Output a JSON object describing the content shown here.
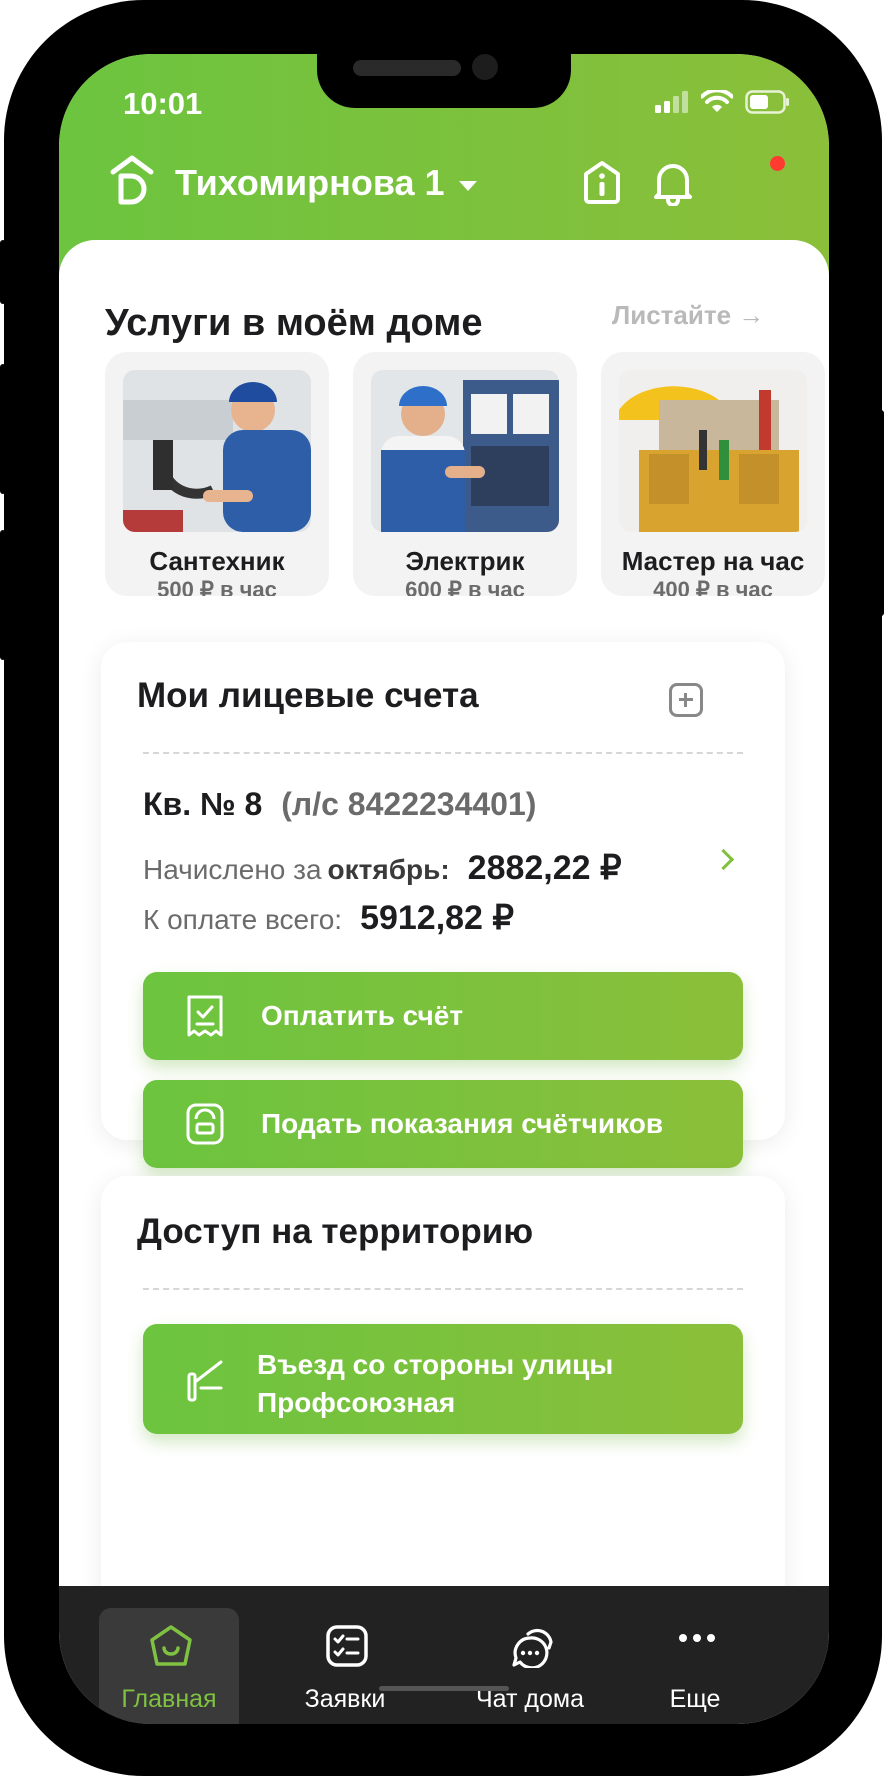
{
  "status_bar": {
    "time": "10:01"
  },
  "header": {
    "address": "Тихомирнова 1"
  },
  "services": {
    "title": "Услуги в моём доме",
    "swipe_hint": "Листайте →",
    "items": [
      {
        "name": "Сантехник",
        "price": "500 ₽ в час"
      },
      {
        "name": "Электрик",
        "price": "600 ₽ в час"
      },
      {
        "name": "Мастер на час",
        "price": "400 ₽ в час"
      }
    ]
  },
  "accounts": {
    "title": "Мои лицевые счета",
    "apartment": "Кв. № 8",
    "account_number": "(л/с 8422234401)",
    "charged_label": "Начислено за",
    "charged_month": "октябрь:",
    "charged_amount": "2882,22 ₽",
    "total_label": "К оплате всего:",
    "total_amount": "5912,82 ₽",
    "pay_button": "Оплатить счёт",
    "meters_button": "Подать показания счётчиков"
  },
  "access": {
    "title": "Доступ на территорию",
    "entry_line1": "Въезд со стороны улицы",
    "entry_line2": "Профсоюзная"
  },
  "tabs": [
    {
      "label": "Главная",
      "icon": "home-icon",
      "active": true
    },
    {
      "label": "Заявки",
      "icon": "checklist-icon",
      "active": false
    },
    {
      "label": "Чат дома",
      "icon": "chat-icon",
      "active": false
    },
    {
      "label": "Еще",
      "icon": "more-icon",
      "active": false
    }
  ],
  "colors": {
    "brand_green": "#7dc13f",
    "notification": "#ff3b30",
    "tabbar": "#222222"
  }
}
